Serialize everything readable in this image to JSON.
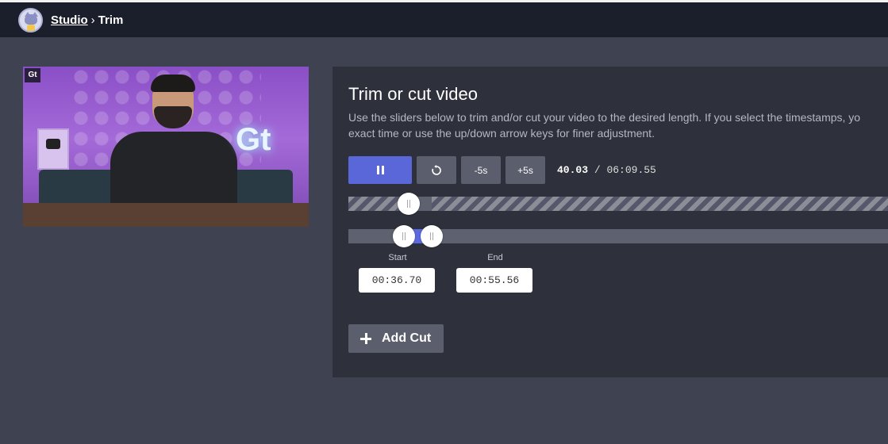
{
  "breadcrumb": {
    "root": "Studio",
    "separator": "›",
    "current": "Trim"
  },
  "avatar": {
    "icon": "cat-avatar-icon"
  },
  "video": {
    "logo_text": "Gt",
    "overlay_text": "Gt",
    "playback_fraction": 0.108
  },
  "editor": {
    "title": "Trim or cut video",
    "description_line1": "Use the sliders below to trim and/or cut your video to the desired length. If you select the timestamps, yo",
    "description_line2": "exact time or use the up/down arrow keys for finer adjustment.",
    "controls": {
      "play_pause_icon": "pause-icon",
      "restart_icon": "restart-icon",
      "back_label": "-5s",
      "forward_label": "+5s",
      "current_time": "40.03",
      "time_separator": "/",
      "total_time": "06:09.55"
    },
    "trim": {
      "start_label": "Start",
      "end_label": "End",
      "start_value": "00:36.70",
      "end_value": "00:55.56",
      "start_fraction": 0.0994,
      "end_fraction": 0.1504
    },
    "add_cut_label": "Add Cut"
  },
  "colors": {
    "accent": "#5967d8",
    "background": "#3f4250",
    "card": "#2e303b",
    "topbar": "#1b1e2b"
  }
}
